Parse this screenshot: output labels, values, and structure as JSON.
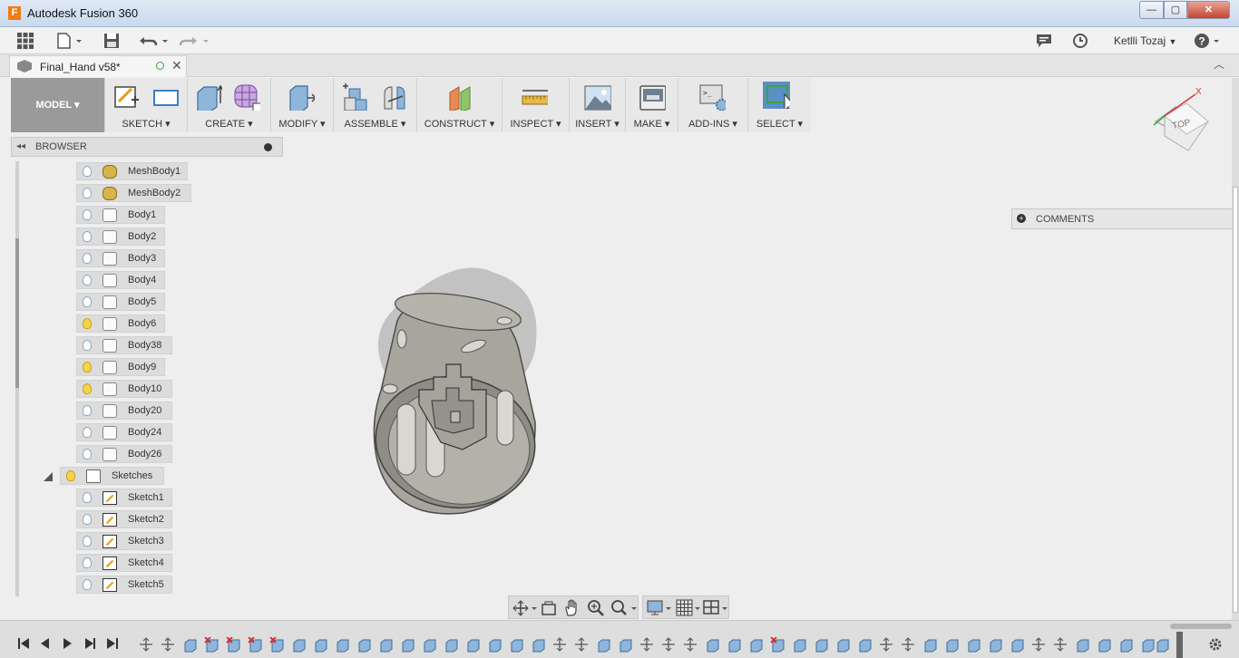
{
  "window": {
    "title": "Autodesk Fusion 360",
    "app_letter": "F",
    "min": "—",
    "max": "▢",
    "close": "✕"
  },
  "qat": {
    "user": "Ketlli Tozaj",
    "user_caret": "▼",
    "help": "?"
  },
  "document": {
    "tab_name": "Final_Hand v58*",
    "close": "✕",
    "collapse": "⌃"
  },
  "toolbar": {
    "workspace": "MODEL ▾",
    "groups": [
      "SKETCH ▾",
      "CREATE ▾",
      "MODIFY ▾",
      "ASSEMBLE ▾",
      "CONSTRUCT ▾",
      "INSPECT ▾",
      "INSERT ▾",
      "MAKE ▾",
      "ADD-INS ▾",
      "SELECT ▾"
    ]
  },
  "browser": {
    "title": "BROWSER",
    "collapse_arrows": "◂◂",
    "items": [
      {
        "label": "MeshBody1",
        "type": "mesh",
        "visible": false
      },
      {
        "label": "MeshBody2",
        "type": "mesh",
        "visible": false
      },
      {
        "label": "Body1",
        "type": "body",
        "visible": false
      },
      {
        "label": "Body2",
        "type": "body",
        "visible": false
      },
      {
        "label": "Body3",
        "type": "body",
        "visible": false
      },
      {
        "label": "Body4",
        "type": "body",
        "visible": false
      },
      {
        "label": "Body5",
        "type": "body",
        "visible": false
      },
      {
        "label": "Body6",
        "type": "body",
        "visible": true
      },
      {
        "label": "Body38",
        "type": "body",
        "visible": false
      },
      {
        "label": "Body9",
        "type": "body",
        "visible": true
      },
      {
        "label": "Body10",
        "type": "body",
        "visible": true
      },
      {
        "label": "Body20",
        "type": "body",
        "visible": false
      },
      {
        "label": "Body24",
        "type": "body",
        "visible": false
      },
      {
        "label": "Body26",
        "type": "body",
        "visible": false
      }
    ],
    "sketches_folder": {
      "label": "Sketches",
      "visible": true
    },
    "sketches": [
      {
        "label": "Sketch1",
        "visible": false
      },
      {
        "label": "Sketch2",
        "visible": false
      },
      {
        "label": "Sketch3",
        "visible": false
      },
      {
        "label": "Sketch4",
        "visible": false
      },
      {
        "label": "Sketch5",
        "visible": false
      }
    ]
  },
  "comments": {
    "label": "COMMENTS",
    "plus": "+"
  },
  "viewcube": {
    "face": "TOP"
  },
  "colors": {
    "accent": "#4a86c5",
    "select_active": "#5a8fc8",
    "body_fill": "#a8a59d"
  }
}
